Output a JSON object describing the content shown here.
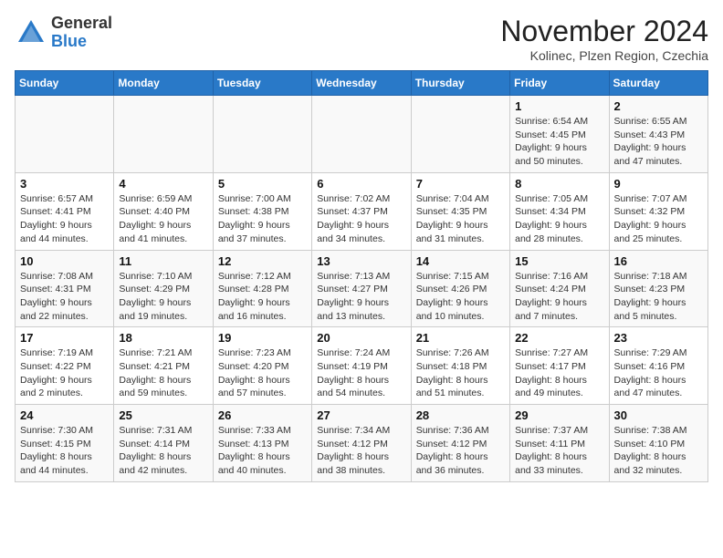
{
  "header": {
    "logo_general": "General",
    "logo_blue": "Blue",
    "month_title": "November 2024",
    "location": "Kolinec, Plzen Region, Czechia"
  },
  "weekdays": [
    "Sunday",
    "Monday",
    "Tuesday",
    "Wednesday",
    "Thursday",
    "Friday",
    "Saturday"
  ],
  "weeks": [
    [
      {
        "day": "",
        "info": ""
      },
      {
        "day": "",
        "info": ""
      },
      {
        "day": "",
        "info": ""
      },
      {
        "day": "",
        "info": ""
      },
      {
        "day": "",
        "info": ""
      },
      {
        "day": "1",
        "info": "Sunrise: 6:54 AM\nSunset: 4:45 PM\nDaylight: 9 hours and 50 minutes."
      },
      {
        "day": "2",
        "info": "Sunrise: 6:55 AM\nSunset: 4:43 PM\nDaylight: 9 hours and 47 minutes."
      }
    ],
    [
      {
        "day": "3",
        "info": "Sunrise: 6:57 AM\nSunset: 4:41 PM\nDaylight: 9 hours and 44 minutes."
      },
      {
        "day": "4",
        "info": "Sunrise: 6:59 AM\nSunset: 4:40 PM\nDaylight: 9 hours and 41 minutes."
      },
      {
        "day": "5",
        "info": "Sunrise: 7:00 AM\nSunset: 4:38 PM\nDaylight: 9 hours and 37 minutes."
      },
      {
        "day": "6",
        "info": "Sunrise: 7:02 AM\nSunset: 4:37 PM\nDaylight: 9 hours and 34 minutes."
      },
      {
        "day": "7",
        "info": "Sunrise: 7:04 AM\nSunset: 4:35 PM\nDaylight: 9 hours and 31 minutes."
      },
      {
        "day": "8",
        "info": "Sunrise: 7:05 AM\nSunset: 4:34 PM\nDaylight: 9 hours and 28 minutes."
      },
      {
        "day": "9",
        "info": "Sunrise: 7:07 AM\nSunset: 4:32 PM\nDaylight: 9 hours and 25 minutes."
      }
    ],
    [
      {
        "day": "10",
        "info": "Sunrise: 7:08 AM\nSunset: 4:31 PM\nDaylight: 9 hours and 22 minutes."
      },
      {
        "day": "11",
        "info": "Sunrise: 7:10 AM\nSunset: 4:29 PM\nDaylight: 9 hours and 19 minutes."
      },
      {
        "day": "12",
        "info": "Sunrise: 7:12 AM\nSunset: 4:28 PM\nDaylight: 9 hours and 16 minutes."
      },
      {
        "day": "13",
        "info": "Sunrise: 7:13 AM\nSunset: 4:27 PM\nDaylight: 9 hours and 13 minutes."
      },
      {
        "day": "14",
        "info": "Sunrise: 7:15 AM\nSunset: 4:26 PM\nDaylight: 9 hours and 10 minutes."
      },
      {
        "day": "15",
        "info": "Sunrise: 7:16 AM\nSunset: 4:24 PM\nDaylight: 9 hours and 7 minutes."
      },
      {
        "day": "16",
        "info": "Sunrise: 7:18 AM\nSunset: 4:23 PM\nDaylight: 9 hours and 5 minutes."
      }
    ],
    [
      {
        "day": "17",
        "info": "Sunrise: 7:19 AM\nSunset: 4:22 PM\nDaylight: 9 hours and 2 minutes."
      },
      {
        "day": "18",
        "info": "Sunrise: 7:21 AM\nSunset: 4:21 PM\nDaylight: 8 hours and 59 minutes."
      },
      {
        "day": "19",
        "info": "Sunrise: 7:23 AM\nSunset: 4:20 PM\nDaylight: 8 hours and 57 minutes."
      },
      {
        "day": "20",
        "info": "Sunrise: 7:24 AM\nSunset: 4:19 PM\nDaylight: 8 hours and 54 minutes."
      },
      {
        "day": "21",
        "info": "Sunrise: 7:26 AM\nSunset: 4:18 PM\nDaylight: 8 hours and 51 minutes."
      },
      {
        "day": "22",
        "info": "Sunrise: 7:27 AM\nSunset: 4:17 PM\nDaylight: 8 hours and 49 minutes."
      },
      {
        "day": "23",
        "info": "Sunrise: 7:29 AM\nSunset: 4:16 PM\nDaylight: 8 hours and 47 minutes."
      }
    ],
    [
      {
        "day": "24",
        "info": "Sunrise: 7:30 AM\nSunset: 4:15 PM\nDaylight: 8 hours and 44 minutes."
      },
      {
        "day": "25",
        "info": "Sunrise: 7:31 AM\nSunset: 4:14 PM\nDaylight: 8 hours and 42 minutes."
      },
      {
        "day": "26",
        "info": "Sunrise: 7:33 AM\nSunset: 4:13 PM\nDaylight: 8 hours and 40 minutes."
      },
      {
        "day": "27",
        "info": "Sunrise: 7:34 AM\nSunset: 4:12 PM\nDaylight: 8 hours and 38 minutes."
      },
      {
        "day": "28",
        "info": "Sunrise: 7:36 AM\nSunset: 4:12 PM\nDaylight: 8 hours and 36 minutes."
      },
      {
        "day": "29",
        "info": "Sunrise: 7:37 AM\nSunset: 4:11 PM\nDaylight: 8 hours and 33 minutes."
      },
      {
        "day": "30",
        "info": "Sunrise: 7:38 AM\nSunset: 4:10 PM\nDaylight: 8 hours and 32 minutes."
      }
    ]
  ]
}
